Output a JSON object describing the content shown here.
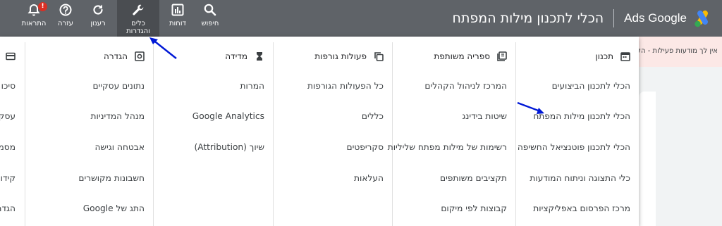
{
  "header": {
    "brand": "Ads Google",
    "page_title": "הכלי לתכנון מילות המפתח",
    "colors": {
      "bar": "#5f6368",
      "annotation_arrow": "#0018d6",
      "badge": "#d93025"
    }
  },
  "toolbar": [
    {
      "id": "search",
      "label": "חיפוש",
      "icon": "search-icon"
    },
    {
      "id": "reports",
      "label": "דוחות",
      "icon": "bar-chart-icon"
    },
    {
      "id": "tools",
      "label_line1": "כלים",
      "label_line2": "והגדרות",
      "icon": "wrench-icon"
    },
    {
      "id": "refresh",
      "label": "רענון",
      "icon": "refresh-icon"
    },
    {
      "id": "help",
      "label": "עזרה",
      "icon": "help-icon"
    },
    {
      "id": "notifications",
      "label": "התראות",
      "icon": "bell-icon",
      "badge": "!"
    }
  ],
  "notice": {
    "text": "אין לך מודעות פעילות - הקמ"
  },
  "menu": {
    "columns": [
      {
        "title": "תכנון",
        "icon": "calendar-icon",
        "items": [
          "הכלי לתכנון הביצועים",
          "הכלי לתכנון מילות המפתח",
          "הכלי לתכנון פוטנציאל החשיפה",
          "כלי התצוגה וניתוח המודעות",
          "מרכז הפרסום באפליקציות"
        ]
      },
      {
        "title": "ספריה משותפת",
        "icon": "library-icon",
        "items": [
          "המרכז לניהול הקהלים",
          "שיטות בידינג",
          "רשימות של מילות מפתח שליליות",
          "תקציבים משותפים",
          "קבוצות לפי מיקום"
        ]
      },
      {
        "title": "פעולות גורפות",
        "icon": "copy-icon",
        "items": [
          "כל הפעולות הגורפות",
          "כללים",
          "סקריפטים",
          "העלאות"
        ]
      },
      {
        "title": "מדידה",
        "icon": "hourglass-icon",
        "items": [
          "המרות",
          "Google Analytics",
          "שיוך (Attribution)"
        ]
      },
      {
        "title": "הגדרה",
        "icon": "settings-icon",
        "items": [
          "נתונים עסקיים",
          "מנהל המדיניות",
          "אבטחה וגישה",
          "חשבונות מקושרים",
          "התג של Google"
        ]
      },
      {
        "title": "",
        "icon": "card-icon",
        "items": [
          "סיכו",
          "עסקי",
          "מסמ",
          "קידו",
          "הגדר"
        ]
      }
    ]
  }
}
